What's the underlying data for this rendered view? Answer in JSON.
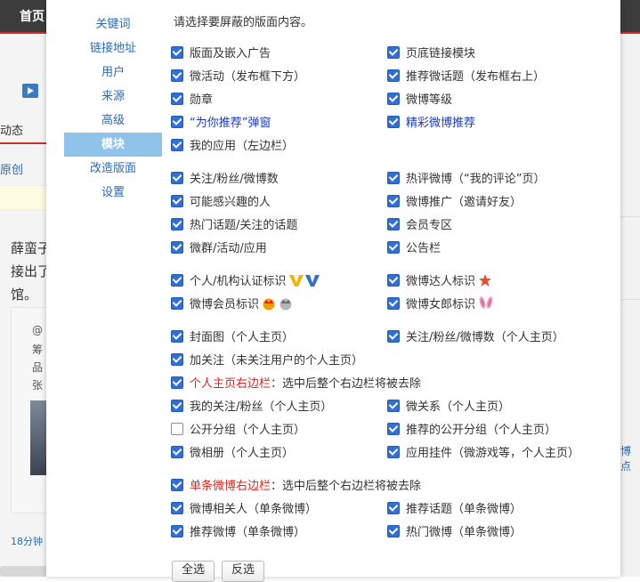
{
  "background": {
    "home_tab": "首页",
    "dongtai": "动态",
    "yuanchuang": "原创",
    "post_lines": [
      "薛蛮子",
      "接出了",
      "馆。"
    ],
    "quote_lines": [
      "@",
      "筹",
      "品",
      "张"
    ],
    "time_text": "18分钟",
    "right_text": "博点"
  },
  "sidebar": {
    "items": [
      {
        "label": "关键词",
        "active": false
      },
      {
        "label": "链接地址",
        "active": false
      },
      {
        "label": "用户",
        "active": false
      },
      {
        "label": "来源",
        "active": false
      },
      {
        "label": "高级",
        "active": false
      },
      {
        "label": "模块",
        "active": true
      },
      {
        "label": "改造版面",
        "active": false
      },
      {
        "label": "设置",
        "active": false
      }
    ]
  },
  "intro": "请选择要屏蔽的版面内容。",
  "groups": {
    "g1": [
      {
        "label": "版面及嵌入广告",
        "checked": true
      },
      {
        "label": "页底链接模块",
        "checked": true
      },
      {
        "label": "微活动（发布框下方）",
        "checked": true
      },
      {
        "label": "推荐微话题（发布框右上）",
        "checked": true
      },
      {
        "label": "勋章",
        "checked": true
      },
      {
        "label": "微博等级",
        "checked": true
      },
      {
        "label": "“为你推荐”弹窗",
        "checked": true
      },
      {
        "label": "精彩微博推荐",
        "checked": true
      },
      {
        "label": "我的应用（左边栏）",
        "checked": true
      }
    ],
    "g2": [
      {
        "label": "关注/粉丝/微博数",
        "checked": true
      },
      {
        "label": "热评微博（“我的评论”页）",
        "checked": true
      },
      {
        "label": "可能感兴趣的人",
        "checked": true
      },
      {
        "label": "微博推广（邀请好友）",
        "checked": true
      },
      {
        "label": "热门话题/关注的话题",
        "checked": true
      },
      {
        "label": "会员专区",
        "checked": true
      },
      {
        "label": "微群/活动/应用",
        "checked": true
      },
      {
        "label": "公告栏",
        "checked": true
      }
    ],
    "g3": [
      {
        "label": "个人/机构认证标识",
        "checked": true,
        "icon": "verified-v-icons"
      },
      {
        "label": "微博达人标识",
        "checked": true,
        "icon": "star-icon"
      },
      {
        "label": "微博会员标识",
        "checked": true,
        "icon": "crown-icons"
      },
      {
        "label": "微博女郎标识",
        "checked": true,
        "icon": "bunny-ears-icon"
      }
    ],
    "g4": [
      {
        "label": "封面图（个人主页）",
        "checked": true
      },
      {
        "label": "关注/粉丝/微博数（个人主页）",
        "checked": true
      },
      {
        "label": "加关注（未关注用户的个人主页）",
        "checked": true
      }
    ],
    "g4_red": {
      "label_red": "个人主页右边栏",
      "label_rest": "：选中后整个右边栏将被去除",
      "checked": true
    },
    "g5": [
      {
        "label": "我的关注/粉丝（个人主页）",
        "checked": true
      },
      {
        "label": "微关系（个人主页）",
        "checked": true
      },
      {
        "label": "公开分组（个人主页）",
        "checked": false
      },
      {
        "label": "推荐的公开分组（个人主页）",
        "checked": true
      },
      {
        "label": "微相册（个人主页）",
        "checked": true
      },
      {
        "label": "应用挂件（微游戏等，个人主页）",
        "checked": true
      }
    ],
    "g6_red": {
      "label_red": "单条微博右边栏",
      "label_rest": "：选中后整个右边栏将被去除",
      "checked": true
    },
    "g6": [
      {
        "label": "微博相关人（单条微博）",
        "checked": true
      },
      {
        "label": "推荐话题（单条微博）",
        "checked": true
      },
      {
        "label": "推荐微博（单条微博）",
        "checked": true
      },
      {
        "label": "热门微博（单条微博）",
        "checked": true
      }
    ]
  },
  "buttons": {
    "select_all": "全选",
    "invert": "反选"
  },
  "colors": {
    "nav_active_bg": "#8fc3ea",
    "link_blue": "#2a6bb0",
    "red_label": "#e0251b",
    "checkbox_blue": "#2f6fd6"
  }
}
